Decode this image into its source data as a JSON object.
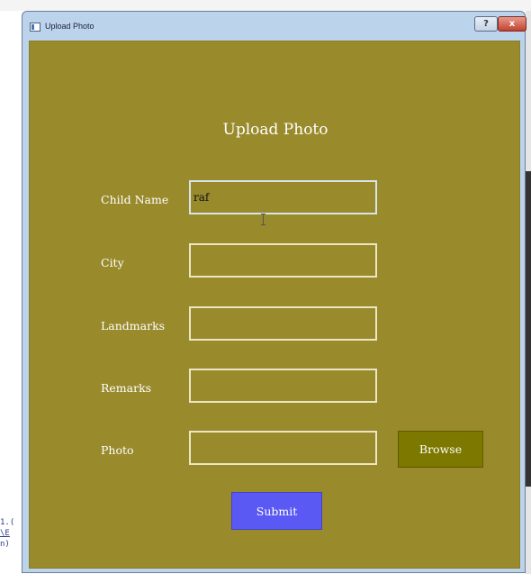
{
  "window": {
    "title": "Upload Photo",
    "help_label": "?",
    "close_label": "x"
  },
  "form": {
    "heading": "Upload Photo",
    "fields": [
      {
        "label": "Child Name",
        "value": "raf"
      },
      {
        "label": "City",
        "value": ""
      },
      {
        "label": "Landmarks",
        "value": ""
      },
      {
        "label": "Remarks",
        "value": ""
      },
      {
        "label": "Photo",
        "value": ""
      }
    ],
    "browse_label": "Browse",
    "submit_label": "Submit"
  },
  "background": {
    "left_fragments": [
      "1.(",
      "\\E",
      "n)"
    ]
  },
  "colors": {
    "form_background": "#998a2c",
    "field_border": "#ece6c4",
    "browse_button": "#7c7800",
    "submit_button": "#5b59f3",
    "text": "#ffffff"
  }
}
